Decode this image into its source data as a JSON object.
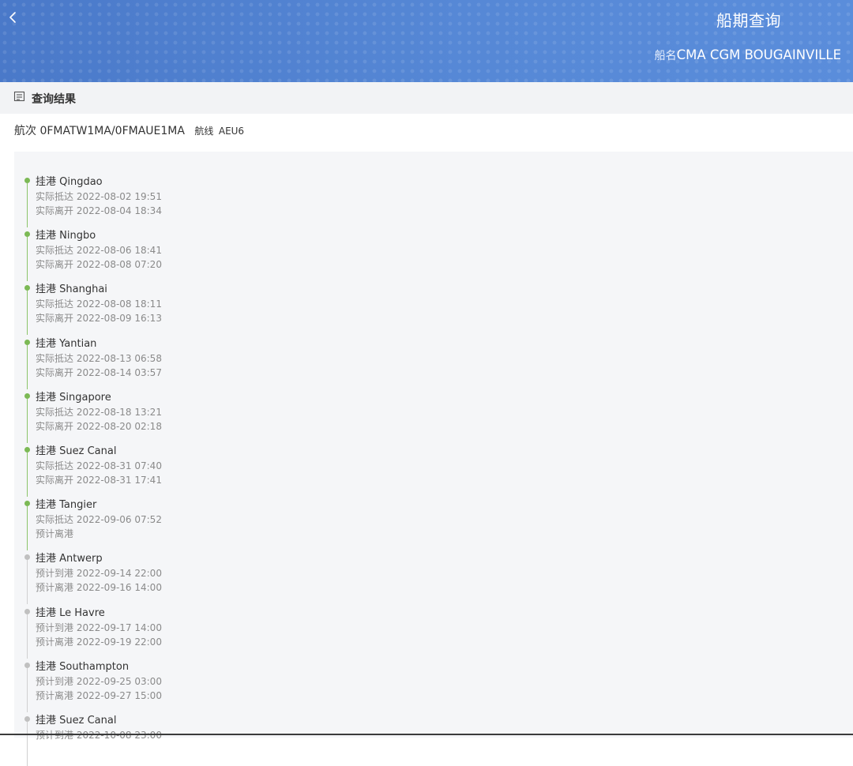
{
  "header": {
    "title": "船期查询",
    "ship_label": "船名",
    "ship_name": "CMA CGM BOUGAINVILLE"
  },
  "section": {
    "title": "查询结果"
  },
  "voyage": {
    "label": "航次",
    "value": "0FMATW1MA/0FMAUE1MA",
    "route_label": "航线",
    "route_value": "AEU6"
  },
  "status_colors": {
    "done": "#7cb955",
    "pending": "#c0c0c0"
  },
  "ports": [
    {
      "port": "挂港 Qingdao",
      "status": "done",
      "line1": "实际抵达 2022-08-02 19:51",
      "line2": "实际离开 2022-08-04 18:34"
    },
    {
      "port": "挂港 Ningbo",
      "status": "done",
      "line1": "实际抵达 2022-08-06 18:41",
      "line2": "实际离开 2022-08-08 07:20"
    },
    {
      "port": "挂港 Shanghai",
      "status": "done",
      "line1": "实际抵达 2022-08-08 18:11",
      "line2": "实际离开 2022-08-09 16:13"
    },
    {
      "port": "挂港 Yantian",
      "status": "done",
      "line1": "实际抵达 2022-08-13 06:58",
      "line2": "实际离开 2022-08-14 03:57"
    },
    {
      "port": "挂港 Singapore",
      "status": "done",
      "line1": "实际抵达 2022-08-18 13:21",
      "line2": "实际离开 2022-08-20 02:18"
    },
    {
      "port": "挂港 Suez Canal",
      "status": "done",
      "line1": "实际抵达 2022-08-31 07:40",
      "line2": "实际离开 2022-08-31 17:41"
    },
    {
      "port": "挂港 Tangier",
      "status": "done",
      "line1": "实际抵达 2022-09-06 07:52",
      "line2": "预计离港"
    },
    {
      "port": "挂港 Antwerp",
      "status": "pending",
      "line1": "预计到港 2022-09-14 22:00",
      "line2": "预计离港 2022-09-16 14:00"
    },
    {
      "port": "挂港 Le Havre",
      "status": "pending",
      "line1": "预计到港 2022-09-17 14:00",
      "line2": "预计离港 2022-09-19 22:00"
    },
    {
      "port": "挂港 Southampton",
      "status": "pending",
      "line1": "预计到港 2022-09-25 03:00",
      "line2": "预计离港 2022-09-27 15:00"
    },
    {
      "port": "挂港 Suez Canal",
      "status": "pending",
      "line1": "预计到港 2022-10-08 23:00",
      "line2": ""
    }
  ]
}
